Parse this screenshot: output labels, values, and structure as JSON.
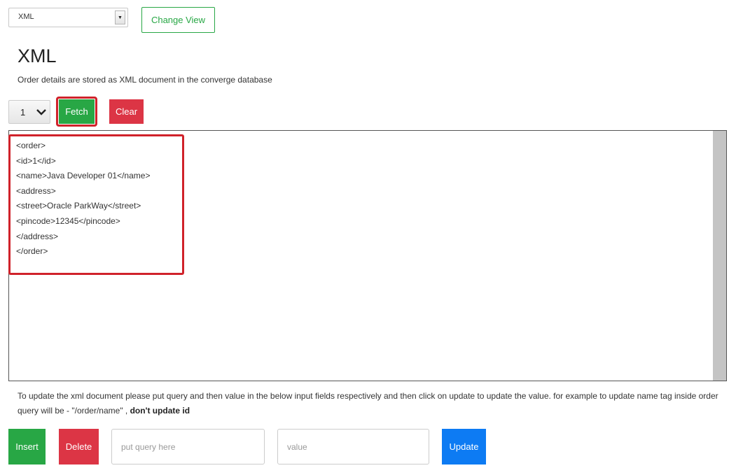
{
  "view_select": {
    "selected": "XML",
    "arrow_glyph": "▼"
  },
  "change_view_label": "Change View",
  "page_title": "XML",
  "subtitle": "Order details are stored as XML document in the converge database",
  "id_select": {
    "selected": "1",
    "chevron": "❯"
  },
  "fetch_label": "Fetch",
  "clear_label": "Clear",
  "xml_lines": [
    "<order>",
    "<id>1</id>",
    "<name>Java Developer 01</name>",
    "<address>",
    "<street>Oracle ParkWay</street>",
    "<pincode>12345</pincode>",
    "</address>",
    "</order>"
  ],
  "help": {
    "text": "To update the xml document please put query and then value in the below input fields respectively and then click on update to update the value. for example to update name tag inside order query will be - \"/order/name\" , ",
    "bold": "don't update id"
  },
  "insert_label": "Insert",
  "delete_label": "Delete",
  "query_input": {
    "value": "",
    "placeholder": "put query here"
  },
  "value_input": {
    "value": "",
    "placeholder": "value"
  },
  "update_label": "Update",
  "colors": {
    "green": "#28a745",
    "red": "#dc3545",
    "blue": "#0d7bf3",
    "highlight": "#d0222a"
  }
}
